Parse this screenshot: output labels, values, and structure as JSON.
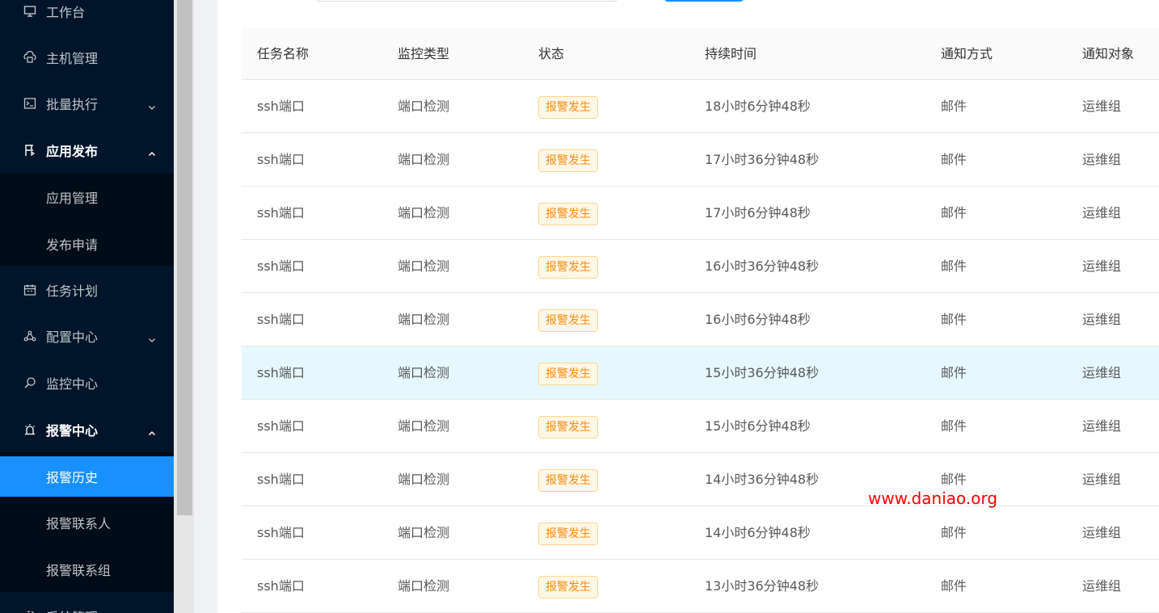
{
  "sidebar": {
    "items": [
      {
        "label": "工作台",
        "icon": "desktop-icon"
      },
      {
        "label": "主机管理",
        "icon": "cloud-server-icon"
      },
      {
        "label": "批量执行",
        "icon": "terminal-icon"
      },
      {
        "label": "应用发布",
        "icon": "flag-icon"
      },
      {
        "label": "任务计划",
        "icon": "calendar-icon"
      },
      {
        "label": "配置中心",
        "icon": "deployment-icon"
      },
      {
        "label": "监控中心",
        "icon": "search-monitor-icon"
      },
      {
        "label": "报警中心",
        "icon": "alarm-icon"
      },
      {
        "label": "系统管理",
        "icon": "setting-icon"
      }
    ],
    "app_submenu": [
      "应用管理",
      "发布申请"
    ],
    "alarm_submenu": [
      "报警历史",
      "报警联系人",
      "报警联系组"
    ]
  },
  "table": {
    "headers": [
      "任务名称",
      "监控类型",
      "状态",
      "持续时间",
      "通知方式",
      "通知对象"
    ],
    "rows": [
      {
        "name": "ssh端口",
        "type": "端口检测",
        "status": "报警发生",
        "duration": "18小时6分钟48秒",
        "notify": "邮件",
        "target": "运维组"
      },
      {
        "name": "ssh端口",
        "type": "端口检测",
        "status": "报警发生",
        "duration": "17小时36分钟48秒",
        "notify": "邮件",
        "target": "运维组"
      },
      {
        "name": "ssh端口",
        "type": "端口检测",
        "status": "报警发生",
        "duration": "17小时6分钟48秒",
        "notify": "邮件",
        "target": "运维组"
      },
      {
        "name": "ssh端口",
        "type": "端口检测",
        "status": "报警发生",
        "duration": "16小时36分钟48秒",
        "notify": "邮件",
        "target": "运维组"
      },
      {
        "name": "ssh端口",
        "type": "端口检测",
        "status": "报警发生",
        "duration": "16小时6分钟48秒",
        "notify": "邮件",
        "target": "运维组"
      },
      {
        "name": "ssh端口",
        "type": "端口检测",
        "status": "报警发生",
        "duration": "15小时36分钟48秒",
        "notify": "邮件",
        "target": "运维组"
      },
      {
        "name": "ssh端口",
        "type": "端口检测",
        "status": "报警发生",
        "duration": "15小时6分钟48秒",
        "notify": "邮件",
        "target": "运维组"
      },
      {
        "name": "ssh端口",
        "type": "端口检测",
        "status": "报警发生",
        "duration": "14小时36分钟48秒",
        "notify": "邮件",
        "target": "运维组"
      },
      {
        "name": "ssh端口",
        "type": "端口检测",
        "status": "报警发生",
        "duration": "14小时6分钟48秒",
        "notify": "邮件",
        "target": "运维组"
      },
      {
        "name": "ssh端口",
        "type": "端口检测",
        "status": "报警发生",
        "duration": "13小时36分钟48秒",
        "notify": "邮件",
        "target": "运维组"
      }
    ]
  },
  "watermark": "www.daniao.org",
  "colors": {
    "sidebar_bg": "#001529",
    "active": "#1890ff",
    "tag_text": "#fa8c16",
    "watermark": "#ff0000"
  }
}
